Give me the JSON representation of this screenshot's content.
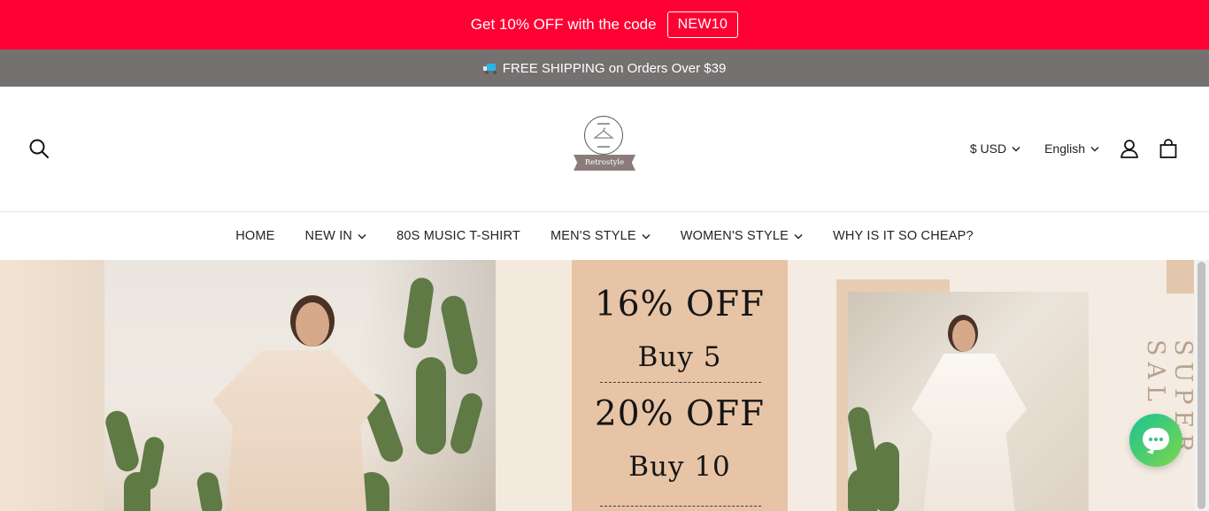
{
  "promo": {
    "text": "Get 10% OFF with the code",
    "code": "NEW10"
  },
  "shipping": {
    "text": "FREE SHIPPING on Orders Over $39",
    "icon": "truck-icon"
  },
  "header": {
    "logo_text": "Retrostyle",
    "currency": "$ USD",
    "language": "English",
    "icons": [
      "search-icon",
      "account-icon",
      "bag-icon"
    ]
  },
  "nav": {
    "items": [
      {
        "label": "HOME",
        "dropdown": false
      },
      {
        "label": "NEW IN",
        "dropdown": true
      },
      {
        "label": "80S MUSIC T-SHIRT",
        "dropdown": false
      },
      {
        "label": "MEN'S STYLE",
        "dropdown": true
      },
      {
        "label": "WOMEN'S STYLE",
        "dropdown": true
      },
      {
        "label": "WHY IS IT SO CHEAP?",
        "dropdown": false
      }
    ]
  },
  "hero": {
    "offer1_pct": "16%  OFF",
    "offer1_qty": "Buy  5",
    "offer2_pct": "20%  OFF",
    "offer2_qty": "Buy  10",
    "side_text": "SUPER SAL"
  },
  "colors": {
    "promo_bg": "#ff0033",
    "shipping_bg": "#747170",
    "chat_start": "#19c394",
    "chat_end": "#7fd64c"
  },
  "chat": {
    "icon": "chat-icon"
  }
}
